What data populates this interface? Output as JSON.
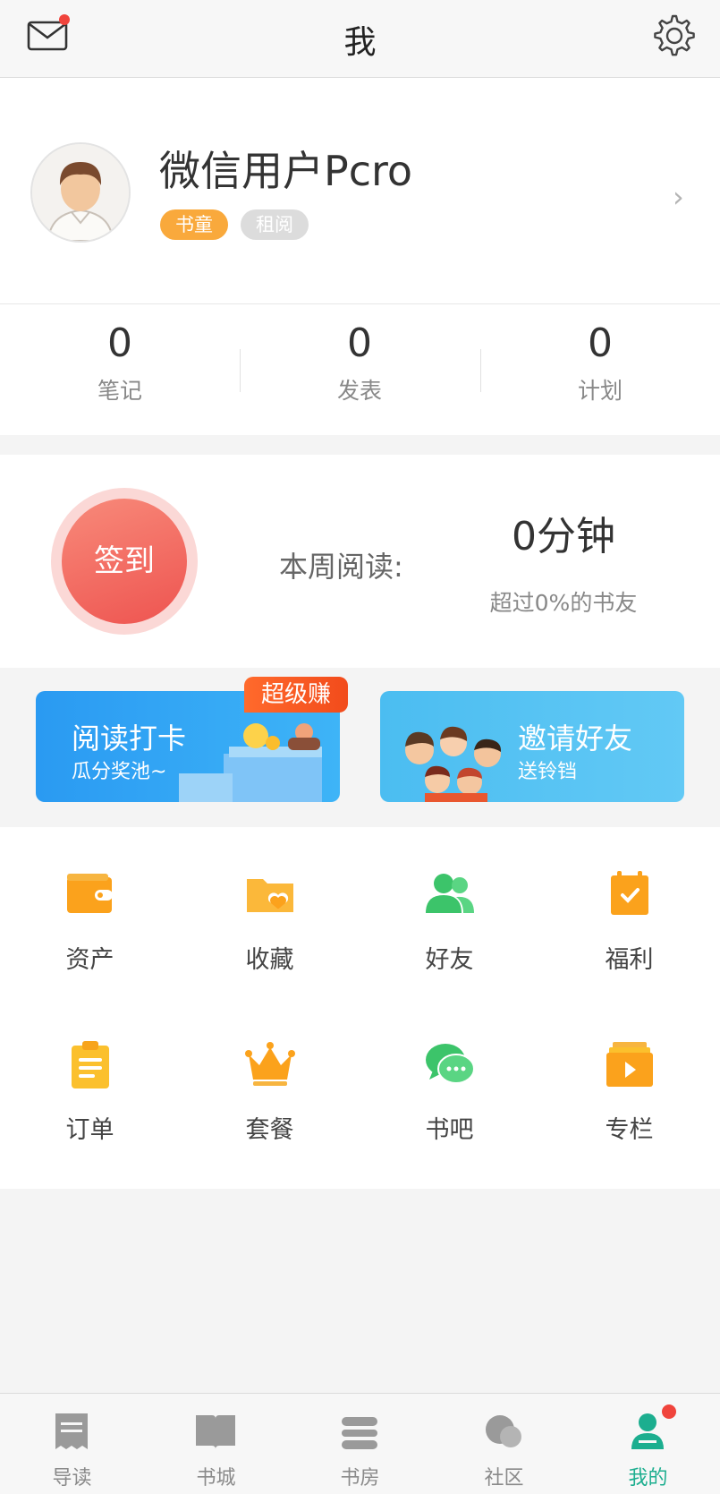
{
  "header": {
    "title": "我",
    "mail_icon": "mail-icon",
    "settings_icon": "gear-icon"
  },
  "profile": {
    "username": "微信用户Pcro",
    "badges": [
      "书童",
      "租阅"
    ],
    "colors": {
      "badge_primary": "#f9a93c",
      "badge_muted": "#dcdcdc"
    }
  },
  "stats": [
    {
      "value": "0",
      "label": "笔记"
    },
    {
      "value": "0",
      "label": "发表"
    },
    {
      "value": "0",
      "label": "计划"
    }
  ],
  "signin": {
    "button_label": "签到",
    "week_label": "本周阅读:",
    "week_value": "0分钟",
    "week_sub": "超过0%的书友"
  },
  "banners": [
    {
      "title": "阅读打卡",
      "subtitle": "瓜分奖池~",
      "tag": "超级赚"
    },
    {
      "title": "邀请好友",
      "subtitle": "送铃铛"
    }
  ],
  "grid": [
    {
      "label": "资产",
      "icon": "wallet-icon"
    },
    {
      "label": "收藏",
      "icon": "favorite-folder-icon"
    },
    {
      "label": "好友",
      "icon": "friends-icon"
    },
    {
      "label": "福利",
      "icon": "calendar-check-icon"
    },
    {
      "label": "订单",
      "icon": "clipboard-icon"
    },
    {
      "label": "套餐",
      "icon": "crown-icon"
    },
    {
      "label": "书吧",
      "icon": "chat-bubble-icon"
    },
    {
      "label": "专栏",
      "icon": "video-column-icon"
    }
  ],
  "tabs": [
    {
      "label": "导读",
      "icon": "receipt-icon"
    },
    {
      "label": "书城",
      "icon": "open-book-icon"
    },
    {
      "label": "书房",
      "icon": "bookshelf-icon"
    },
    {
      "label": "社区",
      "icon": "community-icon"
    },
    {
      "label": "我的",
      "icon": "profile-icon",
      "active": true
    }
  ],
  "colors": {
    "accent": "#1cae8f",
    "sign_red": "#ee5450",
    "notify_red": "#f0443c"
  }
}
